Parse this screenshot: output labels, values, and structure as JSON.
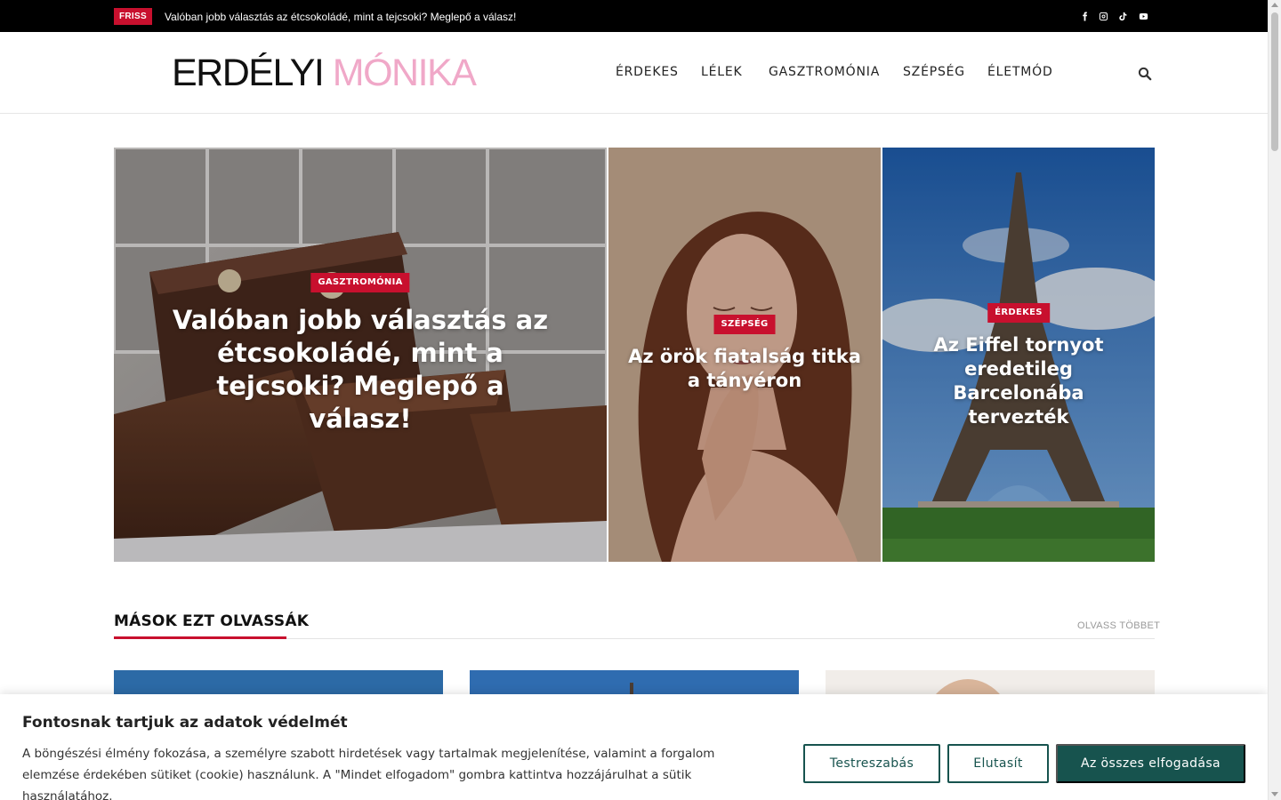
{
  "topbar": {
    "badge": "FRISS",
    "ticker": "Valóban jobb választás az étcsokoládé, mint a tejcsoki? Meglepő a válasz!",
    "social_icons": [
      "facebook-icon",
      "instagram-icon",
      "tiktok-icon",
      "youtube-icon"
    ]
  },
  "header": {
    "logo_part1": "ERDÉLYI",
    "logo_part2": "MÓNIKA",
    "nav": [
      "ÉRDEKES",
      "LÉLEK",
      "GASZTROMÓNIA",
      "SZÉPSÉG",
      "ÉLETMÓD"
    ],
    "search_icon": "search-icon"
  },
  "hero": [
    {
      "category": "GASZTROMÓNIA",
      "title": "Valóban jobb választás az étcsokoládé, mint a tejcsoki? Meglepő a válasz!"
    },
    {
      "category": "SZÉPSÉG",
      "title": "Az örök fiatalság titka a tányéron"
    },
    {
      "category": "ÉRDEKES",
      "title": "Az Eiffel tornyot eredetileg Barcelonába tervezték"
    }
  ],
  "section": {
    "title": "MÁSOK EZT OLVASSÁK",
    "more": "OLVASS TÖBBET"
  },
  "cookie": {
    "title": "Fontosnak tartjuk az adatok védelmét",
    "text": "A böngészési élmény fokozása, a személyre szabott hirdetések vagy tartalmak megjelenítése, valamint a forgalom elemzése érdekében sütiket (cookie) használunk. A \"Mindet elfogadom\" gombra kattintva hozzájárulhat a sütik használatához.",
    "customize": "Testreszabás",
    "reject": "Elutasít",
    "accept": "Az összes elfogadása"
  },
  "colors": {
    "accent_red": "#c8102e",
    "logo_pink": "#f0a8c8",
    "cookie_green": "#17534e"
  }
}
